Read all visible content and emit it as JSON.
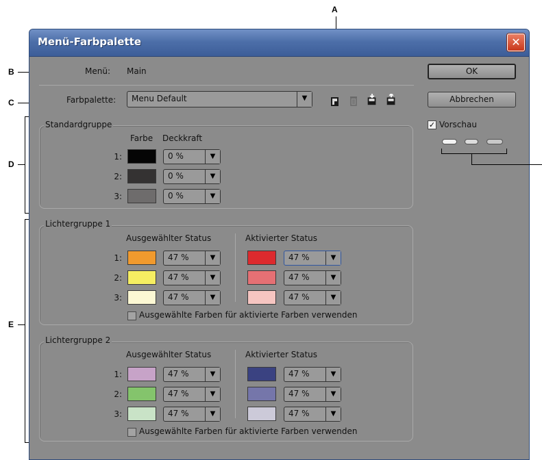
{
  "callouts": {
    "a": "A",
    "b": "B",
    "c": "C",
    "d": "D",
    "e": "E"
  },
  "dialog": {
    "title": "Menü-Farbpalette",
    "close_label": "✕",
    "menu_label": "Menü:",
    "menu_value": "Main",
    "palette_label": "Farbpalette:",
    "palette_value": "Menu Default",
    "ok_label": "OK",
    "cancel_label": "Abbrechen",
    "preview_label": "Vorschau",
    "preview_checked": true
  },
  "icons": {
    "new": "new-palette-icon",
    "delete": "delete-palette-icon",
    "import": "import-palette-icon",
    "export": "export-palette-icon",
    "dropdown": "▼",
    "checkmark": "✓"
  },
  "standard_group": {
    "label": "Standardgruppe",
    "col_color": "Farbe",
    "col_opacity": "Deckkraft",
    "rows": [
      {
        "num": "1:",
        "color": "#050505",
        "opacity": "0 %"
      },
      {
        "num": "2:",
        "color": "#343232",
        "opacity": "0 %"
      },
      {
        "num": "3:",
        "color": "#6e6c6c",
        "opacity": "0 %"
      }
    ]
  },
  "highlight_groups": [
    {
      "label": "Lichtergruppe 1",
      "selected_header": "Ausgewählter Status",
      "activated_header": "Aktivierter Status",
      "rows": [
        {
          "num": "1:",
          "sel_color": "#f09a2e",
          "sel_opacity": "47 %",
          "act_color": "#dc2a2e",
          "act_opacity": "47 %"
        },
        {
          "num": "2:",
          "sel_color": "#f6ee62",
          "sel_opacity": "47 %",
          "act_color": "#e57074",
          "act_opacity": "47 %"
        },
        {
          "num": "3:",
          "sel_color": "#fcf8d4",
          "sel_opacity": "47 %",
          "act_color": "#f6c5c1",
          "act_opacity": "47 %"
        }
      ],
      "checkbox_label": "Ausgewählte Farben für aktivierte Farben verwenden"
    },
    {
      "label": "Lichtergruppe 2",
      "selected_header": "Ausgewählter Status",
      "activated_header": "Aktivierter Status",
      "rows": [
        {
          "num": "1:",
          "sel_color": "#c7a3c8",
          "sel_opacity": "47 %",
          "act_color": "#3a4281",
          "act_opacity": "47 %"
        },
        {
          "num": "2:",
          "sel_color": "#84c46c",
          "sel_opacity": "47 %",
          "act_color": "#7576aa",
          "act_opacity": "47 %"
        },
        {
          "num": "3:",
          "sel_color": "#c9e3c7",
          "sel_opacity": "47 %",
          "act_color": "#cccad9",
          "act_opacity": "47 %"
        }
      ],
      "checkbox_label": "Ausgewählte Farben für aktivierte Farben verwenden"
    }
  ],
  "colors": {
    "dialog_bg": "#8b8b8b",
    "titlebar": "#4d6fa9",
    "close_button": "#c8381b"
  }
}
